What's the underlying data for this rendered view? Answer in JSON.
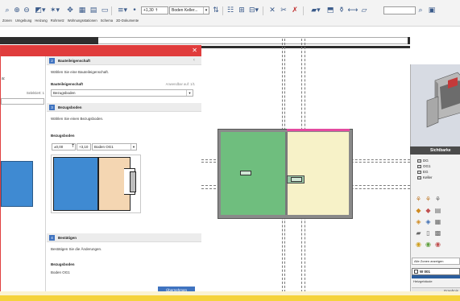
{
  "toolbar": {
    "icons": [
      "lasso-icon",
      "zoom-in-icon",
      "zoom-out-icon",
      "select-filter-icon",
      "snap-icon",
      "move-icon",
      "grid-icon",
      "level-icon",
      "render-icon",
      "paint-icon",
      "dropdown-icon"
    ],
    "elevation_value": "+1,30",
    "level_combo": "Boden Keller...",
    "menu_items": [
      "Zonen",
      "Umgebung",
      "Heizung",
      "Rohrnetz",
      "Wohnungsstationen",
      "Schema",
      "2D-Dokumente"
    ]
  },
  "dialog": {
    "left_pane": {
      "colon_label": "a:",
      "selected_text": "Selektiert: 1"
    },
    "steps": [
      {
        "number": "2",
        "title": "Bauteileigenschaft",
        "instruction": "Wählen Sie eine Bauteileigenschaft.",
        "field_label": "Bauteileigenschaft",
        "applicable": "Anwendbar auf: 1/1",
        "value": "Bezugsboden"
      },
      {
        "number": "3",
        "title": "Bezugsboden",
        "instruction": "Wählen Sie einen Bezugsboden.",
        "field_label": "Bezugsboden",
        "level_from": "±0,00",
        "level_to": "+3,10",
        "level_name": "Boden OG1"
      },
      {
        "number": "4",
        "title": "Bestätigen",
        "instruction": "Bestätigen Sie die Änderungen.",
        "result_label": "Bezugsboden",
        "result_value": "Boden OG1",
        "confirm_label": "Übernehmen"
      }
    ]
  },
  "side_panel": {
    "header": "Sichtbarke",
    "layers": [
      "DG",
      "OG1",
      "EG",
      "Keller"
    ],
    "zone_filter": "Alle Zonen anzeigen",
    "zone_id": "W 001",
    "zone_label": "Heizgebäude",
    "result_label": "Ergebnis"
  },
  "colors": {
    "accent_red": "#e03c3c",
    "step_blue": "#3f73c0",
    "zone_green": "#6fbe7e",
    "zone_yellow": "#f7f2c8",
    "zone_blue": "#3f8ad2",
    "zone_orange": "#f4d6b2"
  }
}
